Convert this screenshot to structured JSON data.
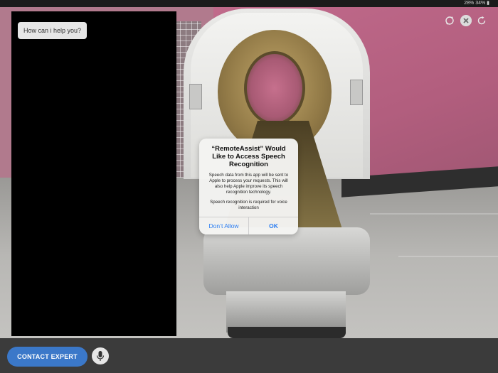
{
  "status_bar": {
    "text": "28% 34% ▮"
  },
  "chat": {
    "bubble_text": "How can i help you?"
  },
  "controls": {
    "refresh_icon": "refresh-icon",
    "close_icon": "close-icon",
    "reload_icon": "reload-icon"
  },
  "dialog": {
    "title": "“RemoteAssist” Would Like to Access Speech Recognition",
    "message": "Speech data from this app will be sent to Apple to process your requests. This will also help Apple improve its speech recognition technology.",
    "usage": "Speech recognition is required for voice interaction",
    "dont_allow_label": "Don’t Allow",
    "ok_label": "OK"
  },
  "bottom": {
    "contact_label": "CONTACT EXPERT",
    "mic_icon": "microphone-icon"
  },
  "colors": {
    "accent": "#3b78c9",
    "ios_blue": "#2a7df3"
  }
}
